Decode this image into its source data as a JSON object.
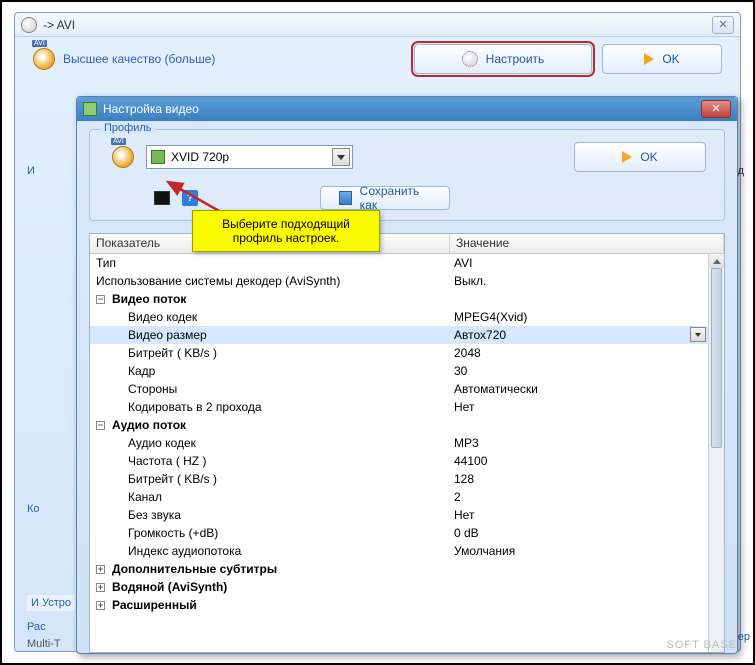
{
  "parent": {
    "title": "-> AVI",
    "quality_label": "Высшее качество (больше)",
    "configure_label": "Настроить",
    "ok_label": "OK"
  },
  "child": {
    "title": "Настройка видео",
    "profile_legend": "Профиль",
    "profile_value": "XVID 720p",
    "ok_label": "OK",
    "saveas_label": "Сохранить как"
  },
  "callout": {
    "line1": "Выберите подходящий",
    "line2": "профиль настроек."
  },
  "grid": {
    "header_key": "Показатель",
    "header_val": "Значение",
    "rows": [
      {
        "k": "Тип",
        "v": "AVI",
        "indent": 0
      },
      {
        "k": "Использование системы декодер (AviSynth)",
        "v": "Выкл.",
        "indent": 0
      },
      {
        "k": "Видео поток",
        "v": "",
        "indent": 0,
        "bold": true,
        "exp": "-"
      },
      {
        "k": "Видео кодек",
        "v": "MPEG4(Xvid)",
        "indent": 2
      },
      {
        "k": "Видео размер",
        "v": "Автох720",
        "indent": 2,
        "selected": true
      },
      {
        "k": "Битрейт ( KB/s )",
        "v": "2048",
        "indent": 2
      },
      {
        "k": "Кадр",
        "v": "30",
        "indent": 2
      },
      {
        "k": "Стороны",
        "v": "Автоматически",
        "indent": 2
      },
      {
        "k": "Кодировать в 2 прохода",
        "v": "Нет",
        "indent": 2
      },
      {
        "k": "Аудио поток",
        "v": "",
        "indent": 0,
        "bold": true,
        "exp": "-"
      },
      {
        "k": "Аудио кодек",
        "v": "MP3",
        "indent": 2
      },
      {
        "k": "Частота ( HZ )",
        "v": "44100",
        "indent": 2
      },
      {
        "k": "Битрейт ( KB/s )",
        "v": "128",
        "indent": 2
      },
      {
        "k": "Канал",
        "v": "2",
        "indent": 2
      },
      {
        "k": "Без звука",
        "v": "Нет",
        "indent": 2
      },
      {
        "k": "Громкость (+dB)",
        "v": "0 dB",
        "indent": 2
      },
      {
        "k": "Индекс аудиопотока",
        "v": "Умолчания",
        "indent": 2
      },
      {
        "k": "Дополнительные субтитры",
        "v": "",
        "indent": 0,
        "bold": true,
        "exp": "+"
      },
      {
        "k": "Водяной (AviSynth)",
        "v": "",
        "indent": 0,
        "bold": true,
        "exp": "+"
      },
      {
        "k": "Расширенный",
        "v": "",
        "indent": 0,
        "bold": true,
        "exp": "+"
      }
    ]
  },
  "bg": {
    "im": "И",
    "device": "И Устро",
    "ras": "Рас",
    "multi": "Multi-T",
    "konv": "конвер",
    "d": "ъ д",
    "ko": "Ко"
  },
  "watermark": "SOFT   BASE"
}
